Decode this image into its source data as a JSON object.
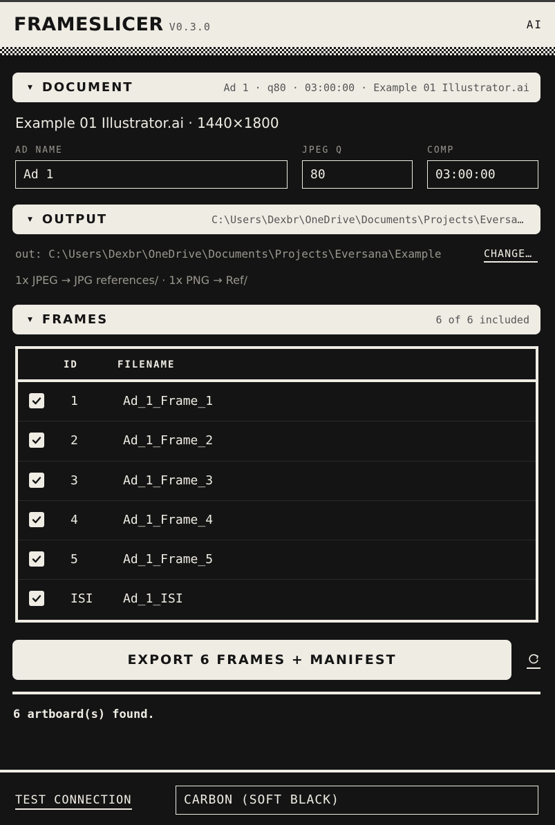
{
  "header": {
    "brand": "FRAMESLICER",
    "version": "V0.3.0",
    "badge": "AI"
  },
  "document": {
    "title": "DOCUMENT",
    "meta": "Ad 1 · q80 · 03:00:00 · Example 01 Illustrator.ai",
    "file_info": "Example 01 Illustrator.ai · 1440×1800",
    "ad_name_label": "AD NAME",
    "ad_name_value": "Ad 1",
    "jpeg_q_label": "JPEG Q",
    "jpeg_q_value": "80",
    "comp_label": "COMP",
    "comp_value": "03:00:00"
  },
  "output": {
    "title": "OUTPUT",
    "meta": "C:\\Users\\Dexbr\\OneDrive\\Documents\\Projects\\Eversana\\Example",
    "path": "out: C:\\Users\\Dexbr\\OneDrive\\Documents\\Projects\\Eversana\\Example",
    "change_label": "CHANGE…",
    "formats": "1x JPEG → JPG references/ · 1x PNG → Ref/"
  },
  "frames": {
    "title": "FRAMES",
    "meta": "6 of 6 included",
    "columns": {
      "id": "ID",
      "filename": "FILENAME"
    },
    "rows": [
      {
        "id": "1",
        "filename": "Ad_1_Frame_1",
        "checked": true
      },
      {
        "id": "2",
        "filename": "Ad_1_Frame_2",
        "checked": true
      },
      {
        "id": "3",
        "filename": "Ad_1_Frame_3",
        "checked": true
      },
      {
        "id": "4",
        "filename": "Ad_1_Frame_4",
        "checked": true
      },
      {
        "id": "5",
        "filename": "Ad_1_Frame_5",
        "checked": true
      },
      {
        "id": "ISI",
        "filename": "Ad_1_ISI",
        "checked": true
      }
    ]
  },
  "actions": {
    "export_label": "EXPORT 6 FRAMES + MANIFEST",
    "refresh_icon": "refresh-icon"
  },
  "status": "6 artboard(s) found.",
  "footer": {
    "test_connection": "TEST CONNECTION",
    "theme": "CARBON (SOFT BLACK)"
  },
  "colors": {
    "background": "#141414",
    "surface": "#efece4",
    "muted": "#9a978f"
  }
}
